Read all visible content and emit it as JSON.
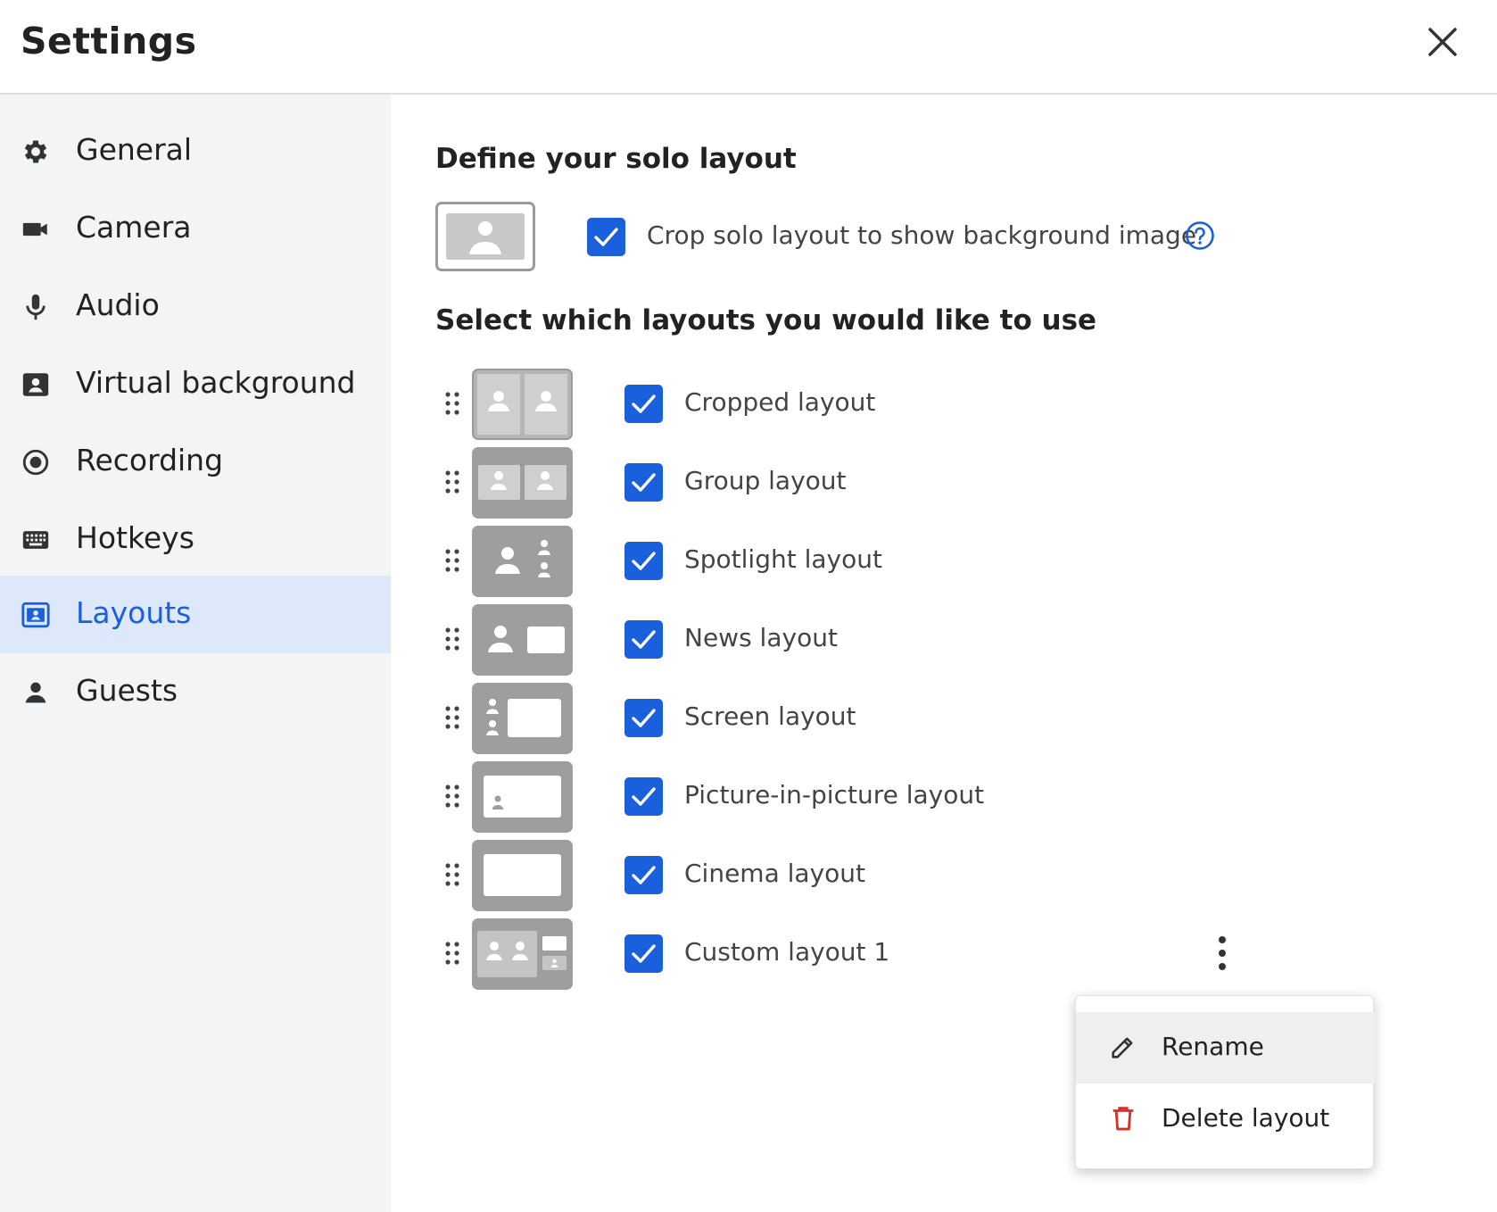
{
  "header": {
    "title": "Settings"
  },
  "sidebar": {
    "items": [
      {
        "label": "General",
        "icon": "gear-icon"
      },
      {
        "label": "Camera",
        "icon": "camera-icon"
      },
      {
        "label": "Audio",
        "icon": "microphone-icon"
      },
      {
        "label": "Virtual background",
        "icon": "portrait-icon"
      },
      {
        "label": "Recording",
        "icon": "record-icon"
      },
      {
        "label": "Hotkeys",
        "icon": "keyboard-icon"
      },
      {
        "label": "Layouts",
        "icon": "layout-icon",
        "active": true
      },
      {
        "label": "Guests",
        "icon": "person-icon"
      }
    ]
  },
  "solo": {
    "title": "Define your solo layout",
    "crop_label": "Crop solo layout to show background image",
    "crop_checked": true
  },
  "layouts": {
    "title": "Select which layouts you would like to use",
    "items": [
      {
        "label": "Cropped layout",
        "checked": true
      },
      {
        "label": "Group layout",
        "checked": true
      },
      {
        "label": "Spotlight layout",
        "checked": true
      },
      {
        "label": "News layout",
        "checked": true
      },
      {
        "label": "Screen layout",
        "checked": true
      },
      {
        "label": "Picture-in-picture layout",
        "checked": true
      },
      {
        "label": "Cinema layout",
        "checked": true
      },
      {
        "label": "Custom layout 1",
        "checked": true
      }
    ]
  },
  "context_menu": {
    "rename": "Rename",
    "delete": "Delete layout"
  },
  "colors": {
    "accent": "#1a5fdc",
    "active_bg": "#dde8fb",
    "sidebar_bg": "#f3f4f6",
    "delete_red": "#d93025",
    "thumb_gray": "#9e9e9e"
  }
}
